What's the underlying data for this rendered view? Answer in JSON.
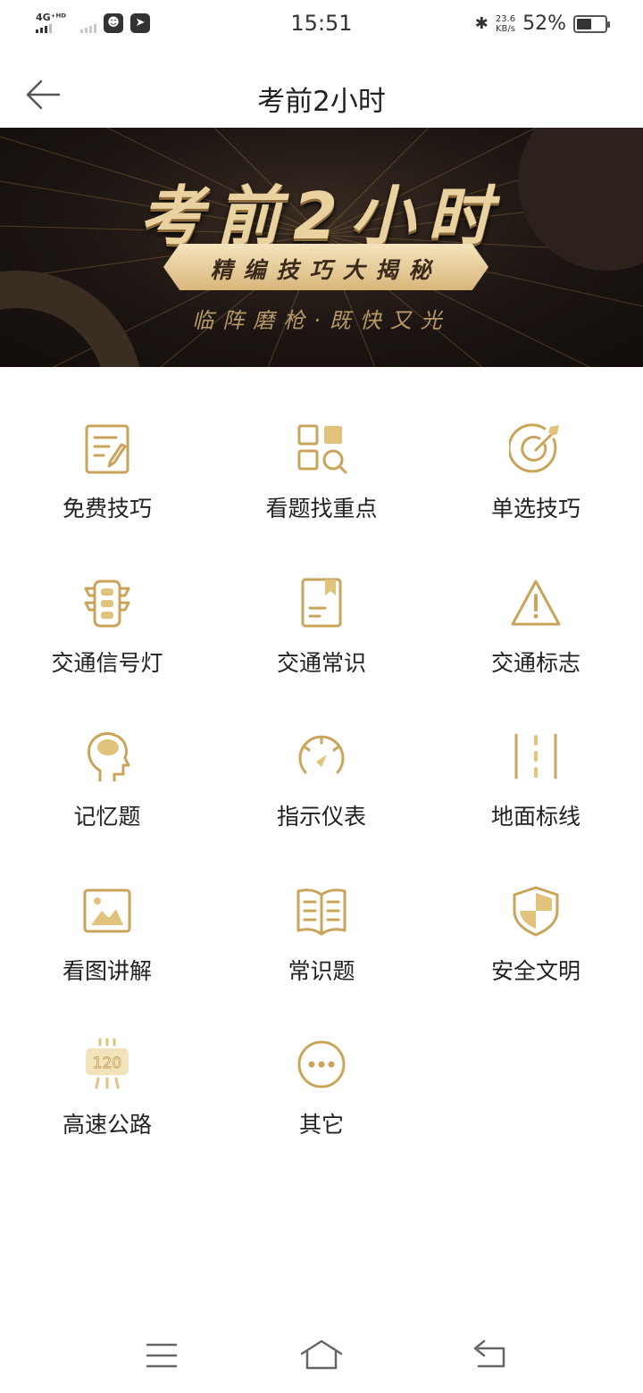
{
  "status_bar": {
    "network": "4G⁺ᴴᴰ",
    "time": "15:51",
    "bluetooth_icon": "bluetooth-icon",
    "net_speed_value": "23.6",
    "net_speed_unit": "KB/s",
    "battery_percent": "52%",
    "battery_level": 0.52
  },
  "header": {
    "title": "考前2小时",
    "back_icon": "arrow-left-icon"
  },
  "banner": {
    "headline": "考前2小时",
    "ribbon": "精编技巧大揭秘",
    "subline": "临阵磨枪·既快又光"
  },
  "accent_color": "#c9a45a",
  "menu": {
    "items": [
      {
        "label": "免费技巧",
        "icon": "note-edit-icon"
      },
      {
        "label": "看题找重点",
        "icon": "grid-search-icon"
      },
      {
        "label": "单选技巧",
        "icon": "target-icon"
      },
      {
        "label": "交通信号灯",
        "icon": "traffic-light-icon"
      },
      {
        "label": "交通常识",
        "icon": "bookmark-doc-icon"
      },
      {
        "label": "交通标志",
        "icon": "warning-triangle-icon"
      },
      {
        "label": "记忆题",
        "icon": "brain-head-icon"
      },
      {
        "label": "指示仪表",
        "icon": "gauge-icon"
      },
      {
        "label": "地面标线",
        "icon": "road-lines-icon"
      },
      {
        "label": "看图讲解",
        "icon": "image-icon"
      },
      {
        "label": "常识题",
        "icon": "open-book-icon"
      },
      {
        "label": "安全文明",
        "icon": "shield-icon"
      },
      {
        "label": "高速公路",
        "icon": "speed-sign-120-icon"
      },
      {
        "label": "其它",
        "icon": "more-dots-icon"
      }
    ]
  },
  "speed_sign_text": "120",
  "nav_bar": {
    "menu_icon": "menu-lines-icon",
    "home_icon": "home-icon",
    "back_icon": "back-return-icon"
  }
}
